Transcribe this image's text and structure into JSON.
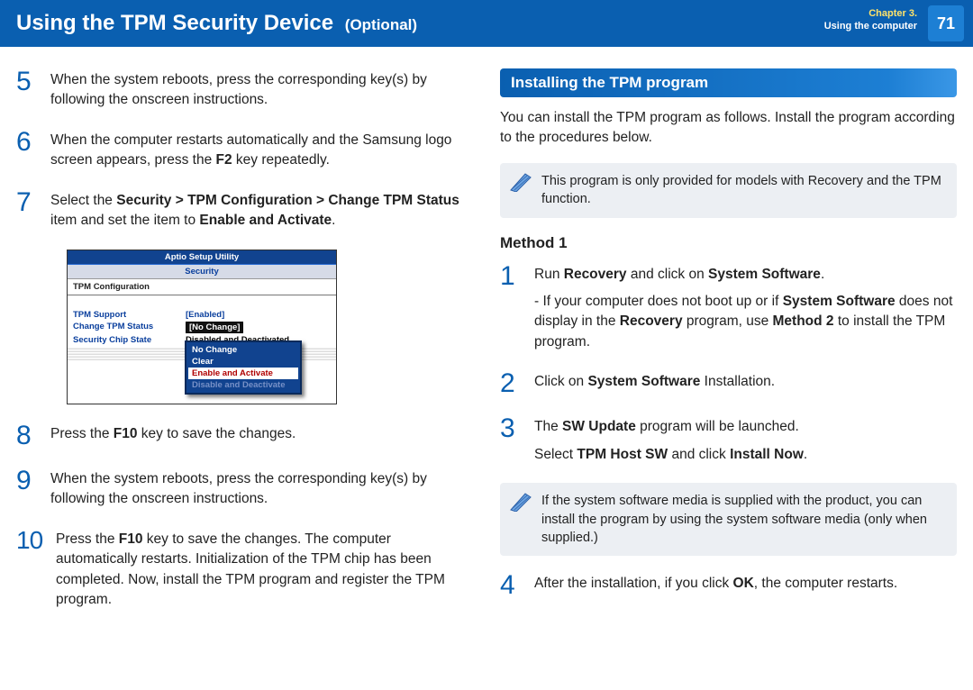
{
  "header": {
    "title_main": "Using the TPM Security Device",
    "title_suffix": "(Optional)",
    "chapter_line1": "Chapter 3.",
    "chapter_line2": "Using the computer",
    "page_number": "71"
  },
  "left_steps": {
    "s5": {
      "num": "5",
      "text": "When the system reboots, press the corresponding key(s) by following the onscreen instructions."
    },
    "s6": {
      "num": "6",
      "text_a": "When the computer restarts automatically and the Samsung logo screen appears, press the ",
      "key": "F2",
      "text_b": " key repeatedly."
    },
    "s7": {
      "num": "7",
      "lead": "Select the ",
      "path": "Security > TPM Configuration > Change TPM Status",
      "mid": " item and set the item to ",
      "setto": "Enable and Activate",
      "tail": "."
    },
    "s8": {
      "num": "8",
      "text_a": "Press the ",
      "key": "F10",
      "text_b": " key to save the changes."
    },
    "s9": {
      "num": "9",
      "text": "When the system reboots, press the corresponding key(s) by following the onscreen instructions."
    },
    "s10": {
      "num": "10",
      "text_a": "Press the ",
      "key": "F10",
      "text_b": " key to save the changes. The computer automatically restarts. Initialization of the TPM chip has been completed. Now, install the TPM program and register the TPM program."
    }
  },
  "bios": {
    "title": "Aptio Setup Utility",
    "tab": "Security",
    "subtitle": "TPM Configuration",
    "rows": {
      "r1_label": "TPM Support",
      "r1_value": "[Enabled]",
      "r2_label": "Change TPM Status",
      "r2_value": "[No Change]",
      "r3_label": "Security Chip State",
      "r3_value": "Disabled and Deactivated"
    },
    "popup": {
      "o1": "No Change",
      "o2": "Clear",
      "o3": "Enable and Activate",
      "o4": "Disable and Deactivate"
    }
  },
  "right": {
    "section_title": "Installing the TPM program",
    "intro": "You can install the TPM program as follows. Install the program according to the procedures below.",
    "note1": "This program is only provided for models with Recovery and the TPM function.",
    "method_label": "Method 1",
    "m1_s1": {
      "num": "1",
      "a": "Run ",
      "b1": "Recovery",
      "c": " and click on ",
      "b2": "System Software",
      "d": ".",
      "sub_a": "- If your computer does not boot up or if ",
      "sub_b1": "System Software",
      "sub_c": " does not display in the ",
      "sub_b2": "Recovery",
      "sub_d": " program, use ",
      "sub_b3": "Method 2",
      "sub_e": " to install the TPM program."
    },
    "m1_s2": {
      "num": "2",
      "a": "Click on ",
      "b": "System Software",
      "c": " Installation."
    },
    "m1_s3": {
      "num": "3",
      "a": "The ",
      "b": "SW Update",
      "c": " program will be launched.",
      "line2_a": "Select ",
      "line2_b1": "TPM Host SW",
      "line2_c": " and click ",
      "line2_b2": "Install Now",
      "line2_d": "."
    },
    "note2": "If the system software media is supplied with the product, you can install the program by using the system software media (only when supplied.)",
    "m1_s4": {
      "num": "4",
      "a": "After the installation, if you click ",
      "b": "OK",
      "c": ", the computer restarts."
    }
  }
}
